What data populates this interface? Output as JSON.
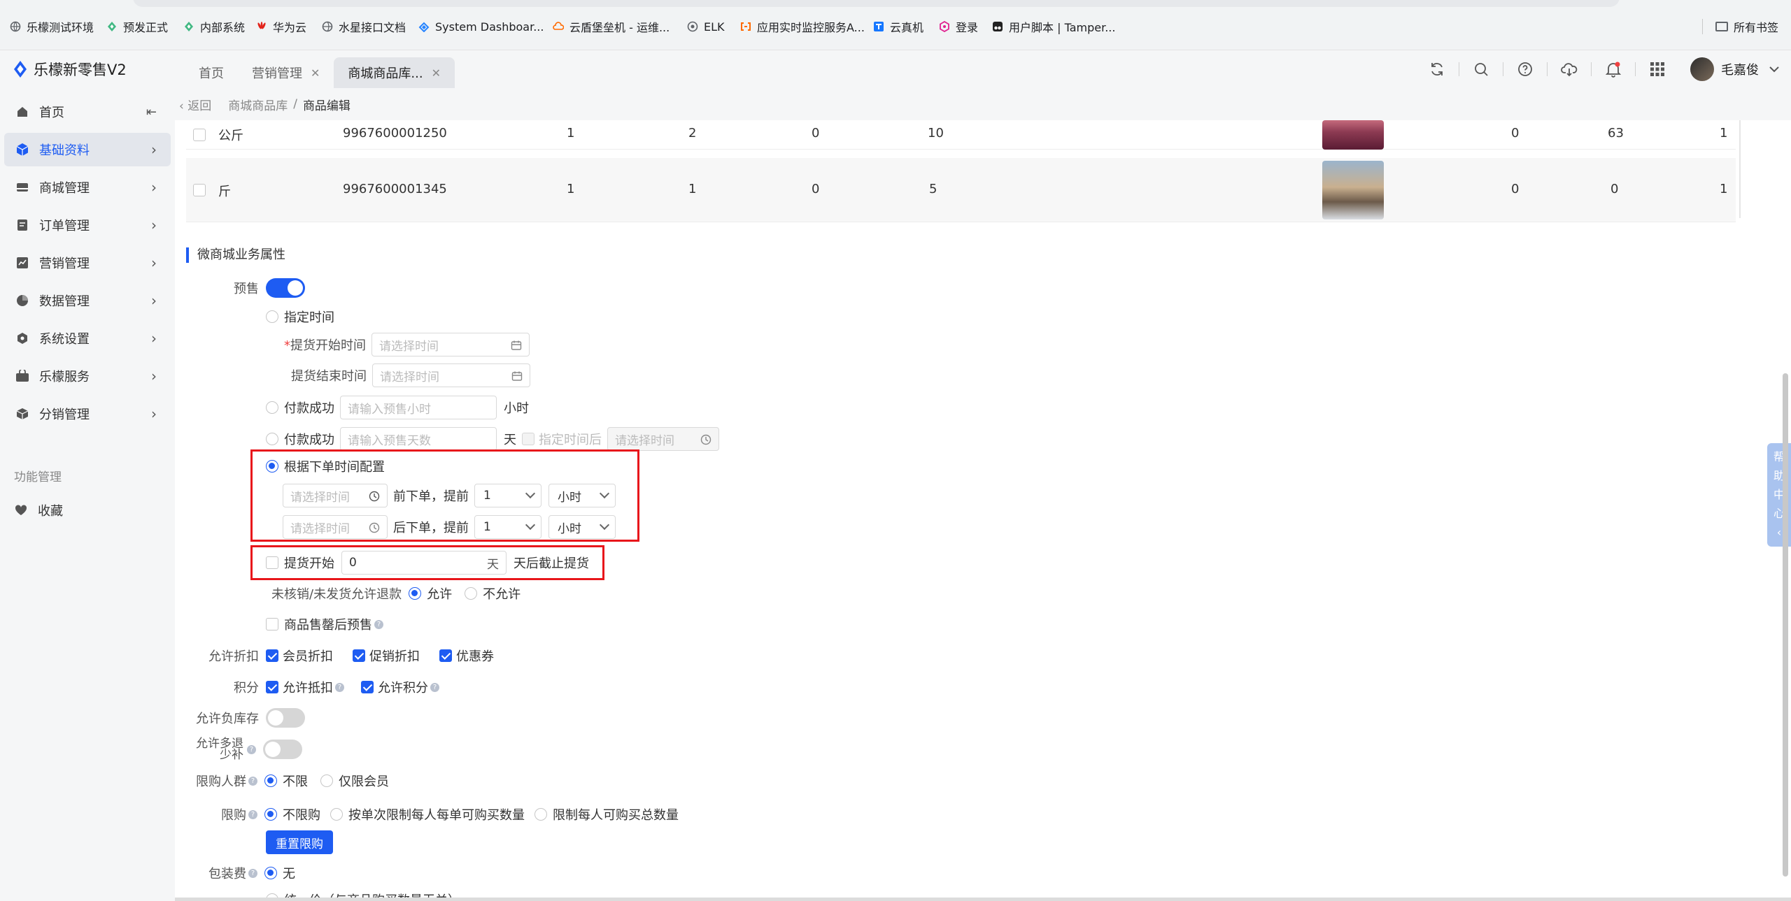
{
  "bookmarks": {
    "items": [
      {
        "label": "乐檬测试环境",
        "icon": "globe-icon",
        "color": "#5f6368"
      },
      {
        "label": "预发正式",
        "icon": "vue-icon",
        "color": "#41b883"
      },
      {
        "label": "内部系统",
        "icon": "vue-icon",
        "color": "#41b883"
      },
      {
        "label": "华为云",
        "icon": "huawei-icon",
        "color": "#e2231a"
      },
      {
        "label": "水星接口文档",
        "icon": "globe-icon",
        "color": "#5f6368"
      },
      {
        "label": "System Dashboar...",
        "icon": "jira-icon",
        "color": "#2684ff"
      },
      {
        "label": "云盾堡垒机 - 运维...",
        "icon": "cloud-shield-icon",
        "color": "#ff6a00"
      },
      {
        "label": "ELK",
        "icon": "elk-icon",
        "color": "#5f6368"
      },
      {
        "label": "应用实时监控服务A...",
        "icon": "arms-icon",
        "color": "#ff6a00"
      },
      {
        "label": "云真机",
        "icon": "t-icon",
        "color": "#1677ff"
      },
      {
        "label": "登录",
        "icon": "hex-icon",
        "color": "#e0208f"
      },
      {
        "label": "用户脚本 | Tamper...",
        "icon": "tampermonkey-icon",
        "color": "#222222"
      }
    ],
    "all_label": "所有书签"
  },
  "header": {
    "app_title": "乐檬新零售V2",
    "tabs": [
      {
        "label": "首页",
        "closable": false,
        "active": false
      },
      {
        "label": "营销管理",
        "closable": true,
        "active": false
      },
      {
        "label": "商城商品库...",
        "closable": true,
        "active": true
      }
    ],
    "user_name": "毛嘉俊"
  },
  "sidebar": {
    "items": [
      {
        "label": "首页",
        "icon": "home-icon"
      },
      {
        "label": "基础资料",
        "icon": "cube-icon",
        "active": true
      },
      {
        "label": "商城管理",
        "icon": "store-icon"
      },
      {
        "label": "订单管理",
        "icon": "order-icon"
      },
      {
        "label": "营销管理",
        "icon": "chart-icon"
      },
      {
        "label": "数据管理",
        "icon": "pie-icon"
      },
      {
        "label": "系统设置",
        "icon": "settings-icon"
      },
      {
        "label": "乐檬服务",
        "icon": "service-icon"
      },
      {
        "label": "分销管理",
        "icon": "distribution-icon"
      }
    ],
    "section_label": "功能管理",
    "favorites_label": "收藏"
  },
  "breadcrumb": {
    "back_label": "返回",
    "parent": "商城商品库",
    "separator": "/",
    "current": "商品编辑"
  },
  "table": {
    "rows": [
      {
        "unit": "公斤",
        "barcode": "9967600001250",
        "c3": "1",
        "c4": "2",
        "c5": "0",
        "c6": "10",
        "c7": "0",
        "c8": "63",
        "c9": "1"
      },
      {
        "unit": "斤",
        "barcode": "9967600001345",
        "c3": "1",
        "c4": "1",
        "c5": "0",
        "c6": "5",
        "c7": "0",
        "c8": "0",
        "c9": "1"
      }
    ]
  },
  "form": {
    "section_title": "微商城业务属性",
    "presale_label": "预售",
    "presale_on": true,
    "option_fixed_time": "指定时间",
    "pickup_start_label": "提货开始时间",
    "pickup_end_label": "提货结束时间",
    "select_time_placeholder": "请选择时间",
    "paid_label": "付款成功",
    "presale_hours_placeholder": "请输入预售小时",
    "hours_unit": "小时",
    "presale_days_placeholder": "请输入预售天数",
    "days_unit": "天",
    "after_fixed_time_label": "指定时间后",
    "by_order_time_label": "根据下单时间配置",
    "before_order_label": "前下单，提前",
    "after_order_label": "后下单，提前",
    "advance_value_1": "1",
    "advance_value_2": "1",
    "advance_unit_1": "小时",
    "advance_unit_2": "小时",
    "pickup_begin_label": "提货开始",
    "pickup_days_value": "0",
    "pickup_days_suffix": "天",
    "pickup_deadline_label": "天后截止提货",
    "refund_label": "未核销/未发货允许退款",
    "refund_allow": "允许",
    "refund_deny": "不允许",
    "sold_out_presale_label": "商品售罄后预售",
    "discount_label": "允许折扣",
    "member_discount": "会员折扣",
    "promo_discount": "促销折扣",
    "coupon": "优惠券",
    "points_label": "积分",
    "allow_deduct": "允许抵扣",
    "allow_points": "允许积分",
    "negative_stock_label": "允许负库存",
    "multi_refund_label_1": "允许多退",
    "multi_refund_label_2": "少补",
    "purchase_group_label": "限购人群",
    "group_unlimited": "不限",
    "group_members_only": "仅限会员",
    "limit_label": "限购",
    "limit_none": "不限购",
    "limit_per_order": "按单次限制每人每单可购买数量",
    "limit_total": "限制每人可购买总数量",
    "reset_limit_button": "重置限购",
    "packing_fee_label": "包装费",
    "packing_none": "无",
    "packing_uniform": "统一价（与商品购买数量无关）"
  },
  "help_center": {
    "chars": [
      "帮",
      "助",
      "中",
      "心"
    ]
  },
  "colors": {
    "primary": "#1e5cf2",
    "highlight_box": "#e8161b"
  }
}
